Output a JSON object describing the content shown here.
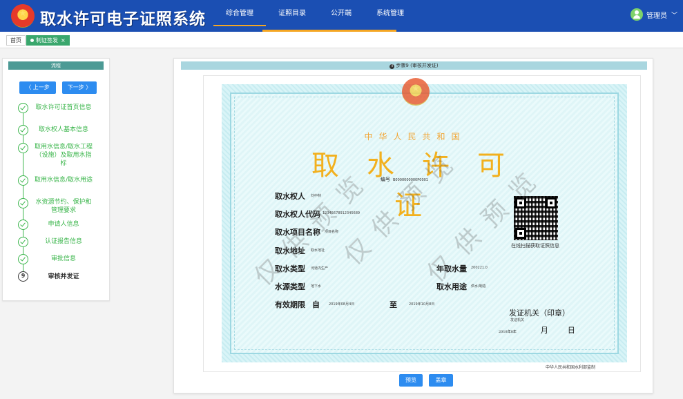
{
  "header": {
    "title": "取水许可电子证照系统",
    "nav": [
      "综合管理",
      "证照目录",
      "公开端",
      "系统管理"
    ],
    "user": "管理员"
  },
  "tabs": {
    "home": "首页",
    "active": "制证签发"
  },
  "left": {
    "header": "流程",
    "prev": "〈 上一步",
    "next": "下一步 〉",
    "steps": [
      "取水许可证首页信息",
      "取水权人基本信息",
      "取用水信息/取水工程（设施）及取用水指标",
      "取用水信息/取水用途",
      "水资源节约、保护和管理要求",
      "申请人信息",
      "认证报告信息",
      "审批信息",
      "审核并发证"
    ],
    "current_num": "9"
  },
  "main": {
    "header": "步骤9 (审核并发证)",
    "preview": "预览",
    "stamp": "盖章"
  },
  "cert": {
    "country": "中华人民共和国",
    "title": "取水许可证",
    "no_label": "编号",
    "no_value": "B0000000000P0001",
    "rows": {
      "holder": {
        "label": "取水权人",
        "value": "刘中林"
      },
      "code": {
        "label": "取水权人代码",
        "value": "12345678912345689"
      },
      "project": {
        "label": "取水项目名称",
        "value": "项目名称"
      },
      "address": {
        "label": "取水地址",
        "value": "取水地址"
      },
      "type": {
        "label": "取水类型",
        "value": "河道内生产"
      },
      "volume": {
        "label": "年取水量",
        "value": "200221.0"
      },
      "source": {
        "label": "水源类型",
        "value": "地下水"
      },
      "usage": {
        "label": "取水用途",
        "value": "供水/制造"
      },
      "valid": {
        "label": "有效期限",
        "from_label": "自",
        "from": "2019年08月4日",
        "to_label": "至",
        "to": "2019年10月8日"
      }
    },
    "qr_caption": "在线扫描获取证照信息",
    "issuer": "发证机关（印章）",
    "issuer_sub": "发证机关",
    "issue_year": "2018年8年",
    "month": "月",
    "day": "日",
    "watermark": "仅供预览",
    "footer": "中华人民共和国水利部监制"
  },
  "colors": {
    "topbar": "#1b4fb3",
    "accent": "#f5a623",
    "success": "#39b54a",
    "primary_button": "#2d8cf0",
    "tab_active": "#3aa76d"
  }
}
